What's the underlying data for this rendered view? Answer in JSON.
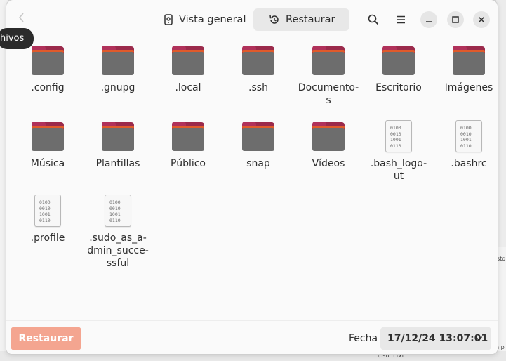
{
  "tooltip": {
    "text": "hivos"
  },
  "header": {
    "tabs": [
      {
        "label": "Vista general",
        "icon": "backup-drive-icon"
      },
      {
        "label": "Restaurar",
        "icon": "history-icon"
      }
    ]
  },
  "files": [
    {
      "name": ".config",
      "type": "folder"
    },
    {
      "name": ".gnupg",
      "type": "folder"
    },
    {
      "name": ".local",
      "type": "folder"
    },
    {
      "name": ".ssh",
      "type": "folder"
    },
    {
      "name": "Documento-s",
      "type": "folder"
    },
    {
      "name": "Escritorio",
      "type": "folder"
    },
    {
      "name": "Imágenes",
      "type": "folder"
    },
    {
      "name": "Música",
      "type": "folder"
    },
    {
      "name": "Plantillas",
      "type": "folder"
    },
    {
      "name": "Público",
      "type": "folder"
    },
    {
      "name": "snap",
      "type": "folder"
    },
    {
      "name": "Vídeos",
      "type": "folder"
    },
    {
      "name": ".bash_logo-ut",
      "type": "file"
    },
    {
      "name": ".bashrc",
      "type": "file"
    },
    {
      "name": ".profile",
      "type": "file"
    },
    {
      "name": ".sudo_as_a-dmin_succe-ssful",
      "type": "file"
    }
  ],
  "file_icon_text": "0100\n0010\n1001\n0110",
  "footer": {
    "restore_label": "Restaurar",
    "date_label": "Fecha",
    "date_value": "17/12/24 13:07:01"
  },
  "background": {
    "bottom_text": "ipsum.txt",
    "right_label": "sto",
    "right_text": "n.p"
  },
  "colors": {
    "accent": "#e95420",
    "restore_button": "#f4a590",
    "folder_front": "#6d6d6d",
    "folder_back": "#9b2a4b"
  }
}
